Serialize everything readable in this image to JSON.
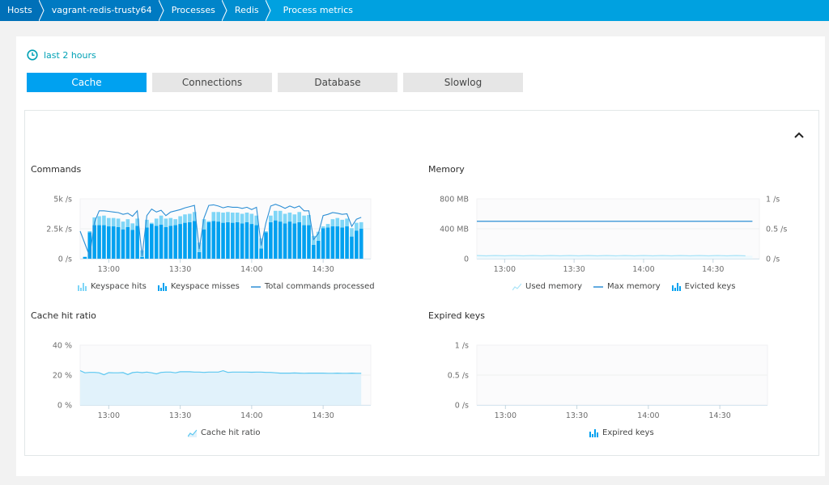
{
  "breadcrumb": [
    {
      "label": "Hosts"
    },
    {
      "label": "vagrant-redis-trusty64"
    },
    {
      "label": "Processes"
    },
    {
      "label": "Redis"
    },
    {
      "label": "Process metrics"
    }
  ],
  "timeframe": {
    "label": "last 2 hours",
    "icon": "clock-icon"
  },
  "tabs": [
    {
      "label": "Cache",
      "active": true
    },
    {
      "label": "Connections",
      "active": false
    },
    {
      "label": "Database",
      "active": false
    },
    {
      "label": "Slowlog",
      "active": false
    }
  ],
  "colors": {
    "accent": "#00a1f0",
    "hits": "#7fd6f7",
    "misses": "#00a1f0",
    "total_line": "#2d8fd5",
    "used_memory": "#a9e4f8",
    "max_memory": "#2d8fd5",
    "hit_ratio_line": "#5cc7f0",
    "hit_ratio_fill": "#e1f2fb"
  },
  "chart_data": [
    {
      "id": "commands",
      "type": "bar",
      "title": "Commands",
      "ylabel": "",
      "y_ticks": [
        "0 /s",
        "2.5k /s",
        "5k /s"
      ],
      "ylim": [
        0,
        5000
      ],
      "x_ticks": [
        "13:00",
        "13:30",
        "14:00",
        "14:30"
      ],
      "x_tick_minutes": [
        780,
        810,
        840,
        870
      ],
      "xlim_minutes": [
        768,
        890
      ],
      "x_minutes": [
        770,
        772,
        774,
        776,
        778,
        780,
        782,
        784,
        786,
        788,
        790,
        792,
        794,
        796,
        798,
        800,
        802,
        804,
        806,
        808,
        810,
        812,
        814,
        816,
        818,
        820,
        822,
        824,
        826,
        828,
        830,
        832,
        834,
        836,
        838,
        840,
        842,
        844,
        846,
        848,
        850,
        852,
        854,
        856,
        858,
        860,
        862,
        864,
        866,
        868,
        870,
        872,
        874,
        876,
        878,
        880,
        882,
        884,
        886
      ],
      "series": [
        {
          "name": "Keyspace hits",
          "kind": "stacked-bar",
          "values": [
            0,
            100,
            650,
            750,
            800,
            700,
            700,
            700,
            650,
            650,
            550,
            600,
            550,
            650,
            100,
            600,
            750,
            700,
            650,
            500,
            650,
            700,
            700,
            750,
            800,
            850,
            100,
            750,
            800,
            850,
            850,
            850,
            800,
            800,
            800,
            850,
            800,
            850,
            100,
            550,
            800,
            900,
            800,
            750,
            750,
            850,
            800,
            850,
            750,
            750,
            150,
            300,
            600,
            700,
            650,
            650,
            700,
            650,
            550,
            600,
            700,
            450,
            400,
            700,
            650
          ]
        },
        {
          "name": "Keyspace misses",
          "kind": "stacked-bar",
          "values": [
            150,
            2200,
            2800,
            2800,
            2800,
            2700,
            2700,
            2650,
            2450,
            2650,
            2400,
            2750,
            150,
            2600,
            2900,
            2750,
            2850,
            2650,
            2750,
            2800,
            2900,
            3000,
            3050,
            3150,
            550,
            2450,
            3050,
            3150,
            3100,
            3000,
            3050,
            3000,
            3050,
            2950,
            3050,
            2900,
            2800,
            850,
            2200,
            3050,
            3200,
            3100,
            2950,
            3100,
            2950,
            3050,
            2800,
            2800,
            1150,
            1500,
            2550,
            2600,
            2700,
            2700,
            2600,
            2700,
            1850,
            2350,
            2500,
            1250,
            1150,
            2650,
            2550
          ]
        },
        {
          "name": "Total commands processed",
          "kind": "line",
          "values": [
            2300,
            200,
            3050,
            4000,
            4000,
            3950,
            3900,
            3850,
            3700,
            3800,
            3550,
            4000,
            200,
            3600,
            4150,
            3900,
            4050,
            3600,
            3900,
            4000,
            4100,
            4250,
            4350,
            4450,
            800,
            3400,
            4450,
            4500,
            4400,
            4250,
            4350,
            4300,
            4300,
            4200,
            4300,
            4100,
            4300,
            1100,
            3000,
            4400,
            4550,
            4400,
            4200,
            4400,
            4250,
            4400,
            4000,
            4000,
            1600,
            2100,
            3600,
            3700,
            3850,
            3800,
            3700,
            3750,
            2700,
            3300,
            3450,
            1800,
            1700,
            3850,
            3600
          ]
        }
      ],
      "legend": [
        "Keyspace hits",
        "Keyspace misses",
        "Total commands processed"
      ],
      "grid": true
    },
    {
      "id": "memory",
      "type": "line",
      "title": "Memory",
      "y_ticks": [
        "0",
        "400 MB",
        "800 MB"
      ],
      "ylim": [
        0,
        800
      ],
      "y2_ticks": [
        "0 /s",
        "0.5 /s",
        "1 /s"
      ],
      "y2lim": [
        0,
        1
      ],
      "x_ticks": [
        "13:00",
        "13:30",
        "14:00",
        "14:30"
      ],
      "x_tick_minutes": [
        780,
        810,
        840,
        870
      ],
      "xlim_minutes": [
        768,
        890
      ],
      "series": [
        {
          "name": "Used memory",
          "kind": "area",
          "x_range": [
            768,
            887
          ],
          "value_mb": 40
        },
        {
          "name": "Max memory",
          "kind": "line",
          "x_range": [
            768,
            887
          ],
          "value_mb": 500
        },
        {
          "name": "Evicted keys",
          "kind": "bar",
          "values": []
        }
      ],
      "legend": [
        "Used memory",
        "Max memory",
        "Evicted keys"
      ],
      "grid": true
    },
    {
      "id": "cache-hit-ratio",
      "type": "area",
      "title": "Cache hit ratio",
      "y_ticks": [
        "0 %",
        "20 %",
        "40 %"
      ],
      "ylim": [
        0,
        40
      ],
      "x_ticks": [
        "13:00",
        "13:30",
        "14:00",
        "14:30"
      ],
      "x_tick_minutes": [
        780,
        810,
        840,
        870
      ],
      "xlim_minutes": [
        768,
        890
      ],
      "x_minutes": [
        768,
        770,
        772,
        774,
        776,
        778,
        780,
        782,
        784,
        786,
        788,
        790,
        792,
        794,
        796,
        798,
        800,
        802,
        804,
        806,
        808,
        810,
        812,
        814,
        816,
        818,
        820,
        822,
        824,
        826,
        828,
        830,
        832,
        834,
        836,
        838,
        840,
        842,
        844,
        846,
        848,
        850,
        852,
        854,
        856,
        858,
        860,
        862,
        864,
        866,
        868,
        870,
        872,
        874,
        876,
        878,
        880,
        882,
        884,
        886
      ],
      "series": [
        {
          "name": "Cache hit ratio",
          "values": [
            23,
            21.5,
            21.8,
            21.8,
            21.5,
            20.2,
            21.6,
            21.5,
            21.5,
            21.7,
            20.4,
            21.7,
            22,
            21.6,
            22,
            21.5,
            20.8,
            21.8,
            22,
            22,
            21.5,
            22.2,
            22.2,
            22.2,
            22,
            22,
            21.8,
            22,
            22,
            22,
            22.9,
            21.8,
            22,
            22,
            22,
            22,
            21.9,
            22,
            22,
            21.8,
            21.8,
            21.5,
            21.3,
            21.3,
            21.3,
            21.4,
            21.3,
            21.2,
            21.3,
            21.3,
            21.3,
            21.3,
            21.2,
            21.2,
            21.3,
            21.2,
            21.2,
            21.3,
            21.2,
            21.2
          ]
        }
      ],
      "legend": [
        "Cache hit ratio"
      ],
      "grid": true
    },
    {
      "id": "expired-keys",
      "type": "bar",
      "title": "Expired keys",
      "y_ticks": [
        "0 /s",
        "0.5 /s",
        "1 /s"
      ],
      "ylim": [
        0,
        1
      ],
      "x_ticks": [
        "13:00",
        "13:30",
        "14:00",
        "14:30"
      ],
      "x_tick_minutes": [
        780,
        810,
        840,
        870
      ],
      "xlim_minutes": [
        768,
        890
      ],
      "series": [
        {
          "name": "Expired keys",
          "values": []
        }
      ],
      "legend": [
        "Expired keys"
      ],
      "grid": true
    }
  ]
}
